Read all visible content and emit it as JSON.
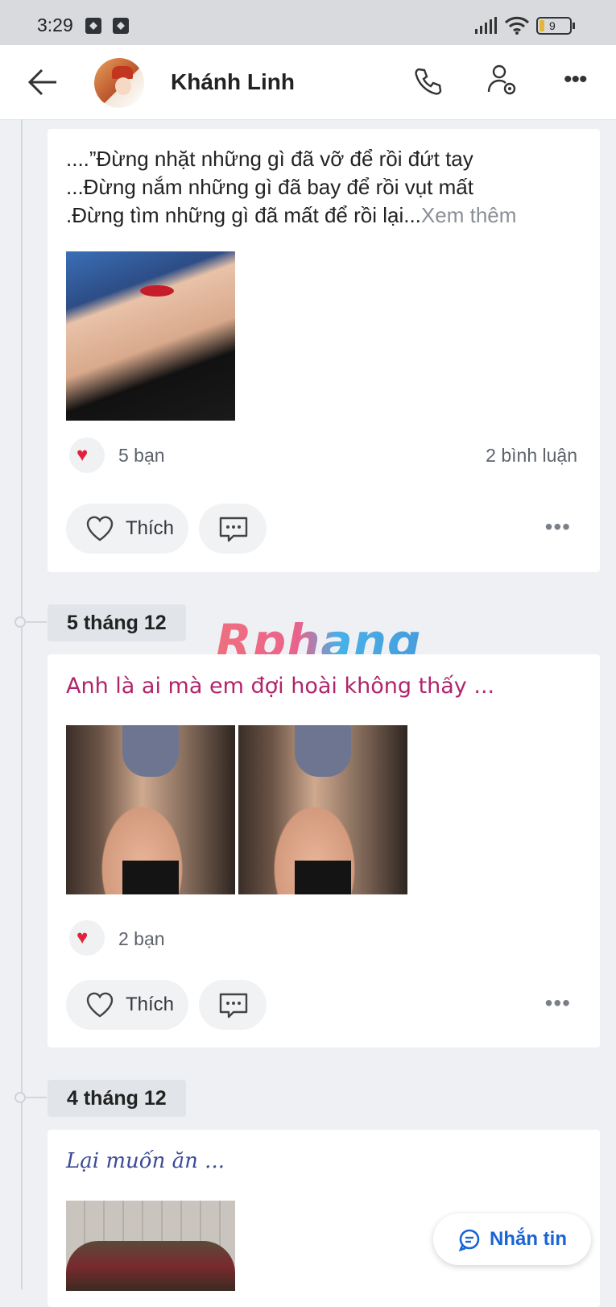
{
  "status_bar": {
    "time": "3:29",
    "battery": "9"
  },
  "header": {
    "contact_name": "Khánh Linh"
  },
  "posts": [
    {
      "text_lines": [
        "....”Đừng nhặt những gì đã vỡ để rồi đứt tay",
        "...Đừng nắm những gì đã bay để rồi vụt mất",
        ".Đừng tìm những gì đã mất để rồi lại..."
      ],
      "see_more": "Xem thêm",
      "reactions": "5 bạn",
      "comments": "2 bình luận",
      "like_label": "Thích"
    },
    {
      "date": "5 tháng 12",
      "text": "Anh là ai mà em đợi hoài không thấy ...",
      "reactions": "2 bạn",
      "like_label": "Thích"
    },
    {
      "date": "4 tháng 12",
      "text": "Lại muốn ăn ..."
    }
  ],
  "watermark": "Rphang",
  "message_button": {
    "label": "Nhắn tin"
  },
  "colors": {
    "accent": "#1a64d6",
    "heart": "#e0233b",
    "pink_text": "#b0246b",
    "blue_text": "#3d4b95"
  }
}
